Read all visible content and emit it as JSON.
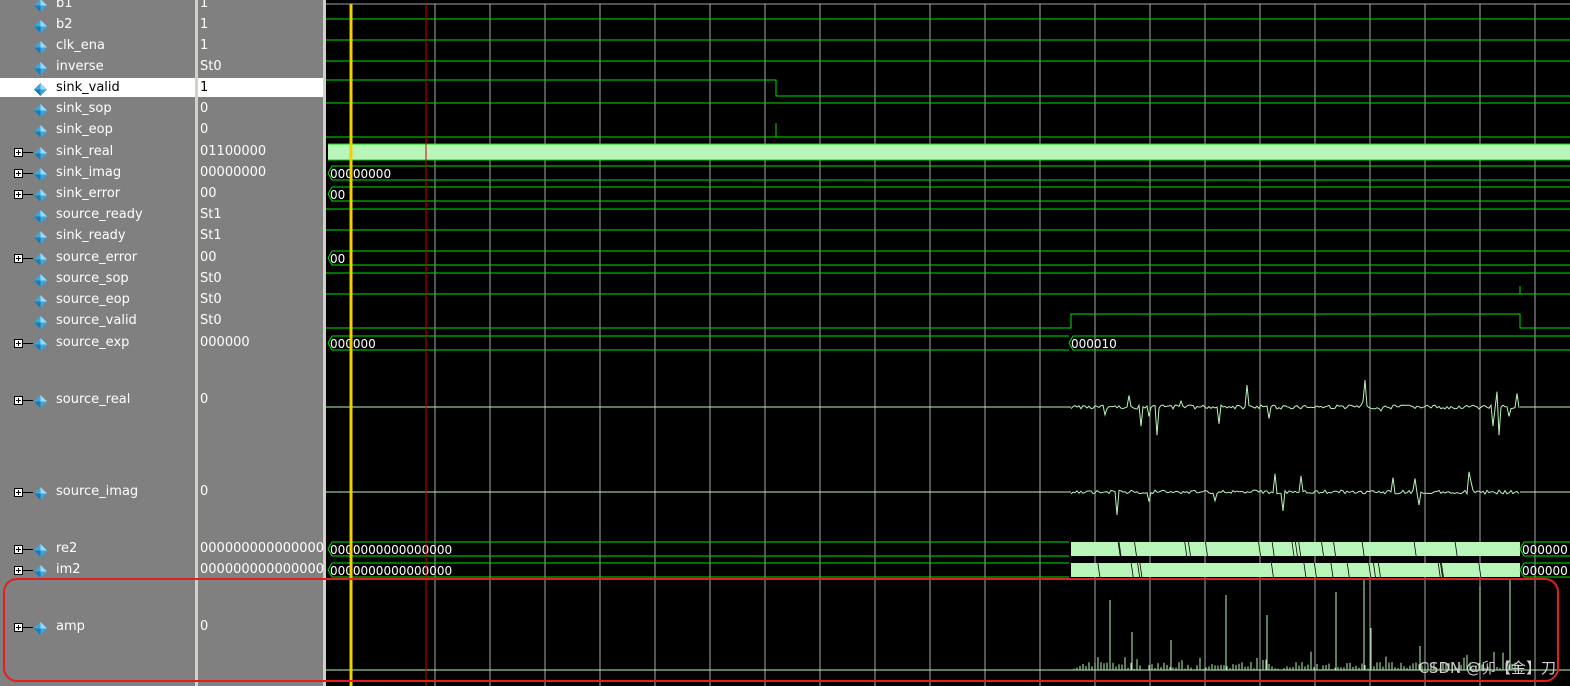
{
  "signals": [
    {
      "id": "b1",
      "name": "b1",
      "value": "1",
      "expandable": false
    },
    {
      "id": "b2",
      "name": "b2",
      "value": "1",
      "expandable": false
    },
    {
      "id": "clk-ena",
      "name": "clk_ena",
      "value": "1",
      "expandable": false
    },
    {
      "id": "inverse",
      "name": "inverse",
      "value": "St0",
      "expandable": false
    },
    {
      "id": "sink-valid",
      "name": "sink_valid",
      "value": "1",
      "expandable": false,
      "selected": true
    },
    {
      "id": "sink-sop",
      "name": "sink_sop",
      "value": "0",
      "expandable": false
    },
    {
      "id": "sink-eop",
      "name": "sink_eop",
      "value": "0",
      "expandable": false
    },
    {
      "id": "sink-real",
      "name": "sink_real",
      "value": "01100000",
      "expandable": true
    },
    {
      "id": "sink-imag",
      "name": "sink_imag",
      "value": "00000000",
      "expandable": true
    },
    {
      "id": "sink-error",
      "name": "sink_error",
      "value": "00",
      "expandable": true
    },
    {
      "id": "source-ready",
      "name": "source_ready",
      "value": "St1",
      "expandable": false
    },
    {
      "id": "sink-ready",
      "name": "sink_ready",
      "value": "St1",
      "expandable": false
    },
    {
      "id": "source-error",
      "name": "source_error",
      "value": "00",
      "expandable": true
    },
    {
      "id": "source-sop",
      "name": "source_sop",
      "value": "St0",
      "expandable": false
    },
    {
      "id": "source-eop",
      "name": "source_eop",
      "value": "St0",
      "expandable": false
    },
    {
      "id": "source-valid",
      "name": "source_valid",
      "value": "St0",
      "expandable": false
    },
    {
      "id": "source-exp",
      "name": "source_exp",
      "value": "000000",
      "expandable": true
    },
    {
      "id": "source-real",
      "name": "source_real",
      "value": "0",
      "expandable": true
    },
    {
      "id": "source-imag",
      "name": "source_imag",
      "value": "0",
      "expandable": true
    },
    {
      "id": "re2",
      "name": "re2",
      "value": "0000000000000000",
      "expandable": true
    },
    {
      "id": "im2",
      "name": "im2",
      "value": "0000000000000000",
      "expandable": true
    },
    {
      "id": "amp",
      "name": "amp",
      "value": "0",
      "expandable": true
    }
  ],
  "bus_labels": {
    "sink_imag": "00000000",
    "sink_error": "00",
    "source_error": "00",
    "source_exp_before": "000000",
    "source_exp_after": "000010",
    "re2_before": "0000000000000000",
    "re2_after": "000000",
    "im2_before": "0000000000000000",
    "im2_after": "000000"
  },
  "colors": {
    "wave": "#00e000",
    "bus_fill": "#b8f5b8",
    "cursor": "#f0d000",
    "marker": "#d00000",
    "grid": "#e0e0e0",
    "pane": "#808080",
    "icon": "#3aa7e0",
    "highlight": "#e02020"
  },
  "watermark": "CSDN @卯【金】刀"
}
